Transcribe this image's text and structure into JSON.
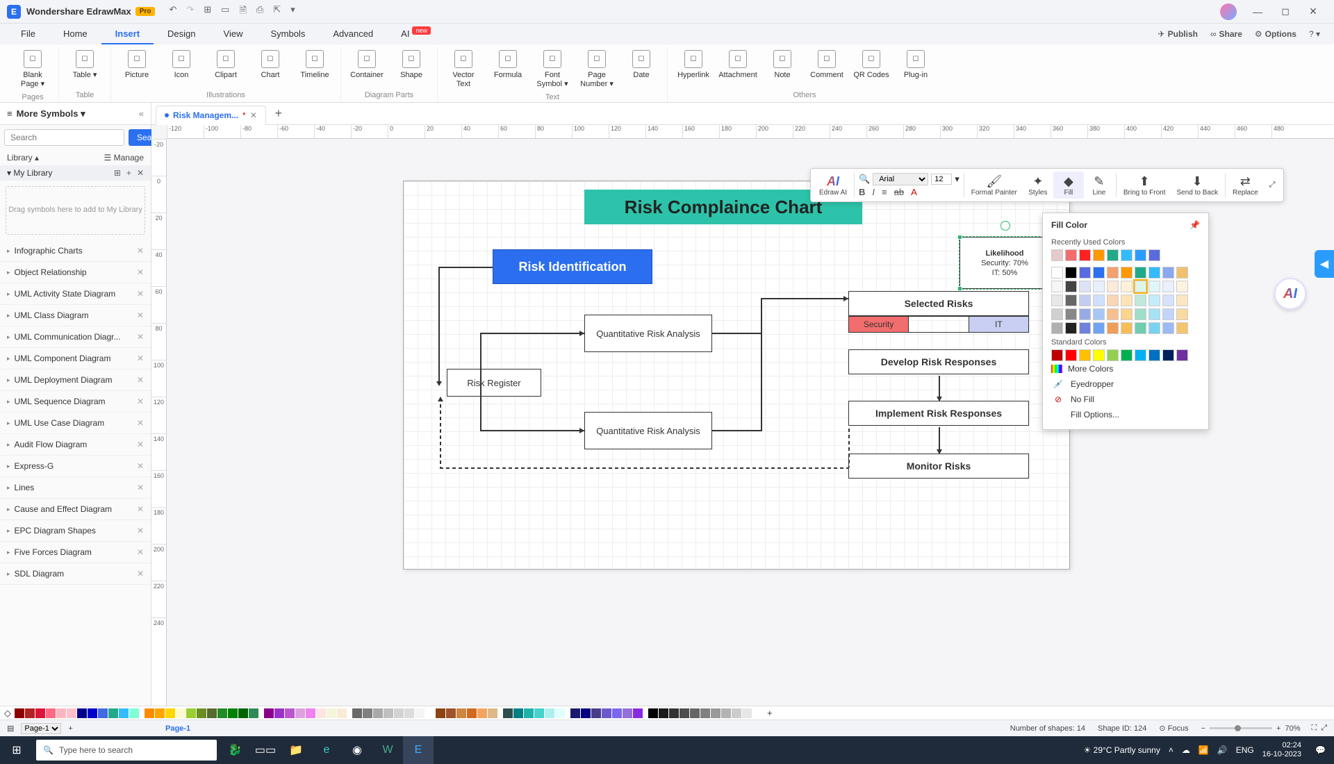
{
  "app": {
    "title": "Wondershare EdrawMax",
    "edition": "Pro"
  },
  "menu": {
    "items": [
      "File",
      "Home",
      "Insert",
      "Design",
      "View",
      "Symbols",
      "Advanced",
      "AI"
    ],
    "active": "Insert",
    "ai_new": "new",
    "right": {
      "publish": "Publish",
      "share": "Share",
      "options": "Options"
    }
  },
  "ribbon": {
    "groups": [
      {
        "label": "Pages",
        "items": [
          {
            "id": "blank-page",
            "label": "Blank Page ▾"
          }
        ]
      },
      {
        "label": "Table",
        "items": [
          {
            "id": "table",
            "label": "Table ▾"
          }
        ]
      },
      {
        "label": "Illustrations",
        "items": [
          {
            "id": "picture",
            "label": "Picture"
          },
          {
            "id": "icon",
            "label": "Icon"
          },
          {
            "id": "clipart",
            "label": "Clipart"
          },
          {
            "id": "chart",
            "label": "Chart"
          },
          {
            "id": "timeline",
            "label": "Timeline"
          }
        ]
      },
      {
        "label": "Diagram Parts",
        "items": [
          {
            "id": "container",
            "label": "Container"
          },
          {
            "id": "shape",
            "label": "Shape"
          }
        ]
      },
      {
        "label": "Text",
        "items": [
          {
            "id": "vector-text",
            "label": "Vector Text"
          },
          {
            "id": "formula",
            "label": "Formula"
          },
          {
            "id": "font-symbol",
            "label": "Font Symbol ▾"
          },
          {
            "id": "page-number",
            "label": "Page Number ▾"
          },
          {
            "id": "date",
            "label": "Date"
          }
        ]
      },
      {
        "label": "Others",
        "items": [
          {
            "id": "hyperlink",
            "label": "Hyperlink"
          },
          {
            "id": "attachment",
            "label": "Attachment"
          },
          {
            "id": "note",
            "label": "Note"
          },
          {
            "id": "comment",
            "label": "Comment"
          },
          {
            "id": "qr",
            "label": "QR Codes"
          },
          {
            "id": "plugin",
            "label": "Plug-in"
          }
        ]
      }
    ]
  },
  "left": {
    "header": "More Symbols",
    "search_placeholder": "Search",
    "search_btn": "Search",
    "library_lbl": "Library",
    "manage_lbl": "Manage",
    "mylib": "My Library",
    "drop_hint": "Drag symbols here to add to My Library",
    "categories": [
      "Infographic Charts",
      "Object Relationship",
      "UML Activity State Diagram",
      "UML Class Diagram",
      "UML Communication Diagr...",
      "UML Component Diagram",
      "UML Deployment Diagram",
      "UML Sequence Diagram",
      "UML Use Case Diagram",
      "Audit Flow Diagram",
      "Express-G",
      "Lines",
      "Cause and Effect Diagram",
      "EPC Diagram Shapes",
      "Five Forces Diagram",
      "SDL Diagram"
    ]
  },
  "tabs": {
    "doc_name": "Risk Managem...",
    "unsaved": "*"
  },
  "diagram": {
    "title": "Risk Complaince Chart",
    "risk_identification": "Risk Identification",
    "risk_register": "Risk Register",
    "qra1": "Quantitative Risk Analysis",
    "qra2": "Quantitative Risk Analysis",
    "selected_risks_hdr": "Selected Risks",
    "security": "Security",
    "it": "IT",
    "develop": "Develop Risk Responses",
    "implement": "Implement Risk Responses",
    "monitor": "Monitor Risks",
    "likelihood": "Likelihood",
    "sec_pct": "Security: 70%",
    "it_pct": "IT: 50%"
  },
  "float_toolbar": {
    "font": "Arial",
    "size": "12",
    "edraw_ai": "Edraw AI",
    "format_painter": "Format Painter",
    "styles": "Styles",
    "fill": "Fill",
    "line": "Line",
    "bring_front": "Bring to Front",
    "send_back": "Send to Back",
    "replace": "Replace"
  },
  "fill_popup": {
    "title": "Fill Color",
    "recent": "Recently Used Colors",
    "standard": "Standard Colors",
    "more": "More Colors",
    "eyedrop": "Eyedropper",
    "nofill": "No Fill",
    "options": "Fill Options...",
    "recent_colors": [
      "#e6c9c9",
      "#f26d6d",
      "#f22",
      "#f90",
      "#2a8",
      "#3bf",
      "#2b9cff",
      "#5a6adf"
    ],
    "theme_colors": [
      [
        "#fff",
        "#000",
        "#5a6adf",
        "#2b70f0",
        "#f2a06d",
        "#f90",
        "#2a8",
        "#3bf",
        "#8aa8f0",
        "#f2c06d"
      ],
      [
        "#f5f5f5",
        "#444",
        "#dde3f7",
        "#e8f0fd",
        "#fcead9",
        "#fef1d9",
        "#def5eb",
        "#e0f5fc",
        "#eaf0fd",
        "#fdf2df"
      ],
      [
        "#e8e8e8",
        "#666",
        "#c3cdf0",
        "#cfe0fb",
        "#f9d6b4",
        "#fde4b4",
        "#bfeadb",
        "#c3ecf9",
        "#d6e2fb",
        "#fbe6c0"
      ],
      [
        "#d0d0d0",
        "#888",
        "#9aaae6",
        "#a7c8f7",
        "#f5c08e",
        "#fbd48e",
        "#9fdfc9",
        "#a6e2f6",
        "#c2d4f9",
        "#f9da9f"
      ],
      [
        "#b0b0b0",
        "#222",
        "#6d82d8",
        "#6fa5f0",
        "#ef9e59",
        "#f7bd59",
        "#6fcdb0",
        "#79d3f0",
        "#9cbaf4",
        "#f4c56f"
      ]
    ],
    "standard_colors": [
      "#c00000",
      "#f00",
      "#ffc000",
      "#ff0",
      "#92d050",
      "#00b050",
      "#00b0f0",
      "#0070c0",
      "#002060",
      "#7030a0"
    ],
    "selected_theme_index": 16
  },
  "status": {
    "page_name": "Page-1",
    "shapes": "Number of shapes: 14",
    "shape_id": "Shape ID: 124",
    "focus": "Focus",
    "zoom": "70%"
  },
  "taskbar": {
    "search_placeholder": "Type here to search",
    "weather": "29°C  Partly sunny",
    "lang": "ENG",
    "time": "02:24",
    "date": "16-10-2023"
  },
  "ruler": {
    "h": [
      "-120",
      "-100",
      "-80",
      "-60",
      "-40",
      "-20",
      "0",
      "20",
      "40",
      "60",
      "80",
      "100",
      "120",
      "140",
      "160",
      "180",
      "200",
      "220",
      "240",
      "260",
      "280",
      "300",
      "320",
      "340",
      "360",
      "380",
      "400",
      "420",
      "440",
      "460",
      "480"
    ],
    "v": [
      "-20",
      "0",
      "20",
      "40",
      "60",
      "80",
      "100",
      "120",
      "140",
      "160",
      "180",
      "200",
      "220",
      "240"
    ]
  }
}
